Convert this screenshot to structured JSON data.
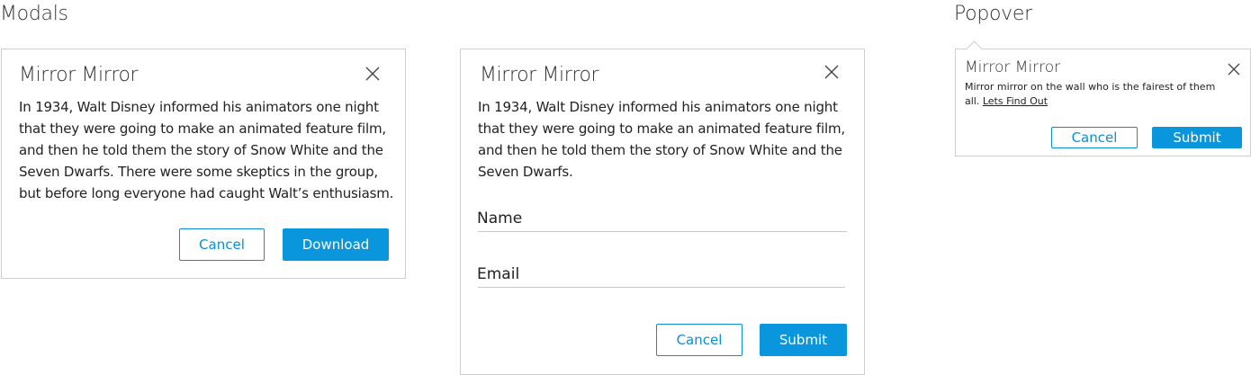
{
  "sections": {
    "modals": "Modals",
    "popover": "Popover"
  },
  "modal1": {
    "title": "Mirror Mirror",
    "body": "In 1934, Walt Disney informed his animators one night that they were going to make an animated feature film, and then he told them the story of Snow White and the Seven Dwarfs. There were some skeptics in the group, but before long everyone had caught Walt’s enthusiasm.",
    "cancel": "Cancel",
    "primary": "Download"
  },
  "modal2": {
    "title": "Mirror Mirror",
    "body": "In 1934, Walt Disney informed his animators one night that they were going to make an animated feature film, and then he told them the story of Snow White and the Seven Dwarfs.",
    "name_label": "Name",
    "email_label": "Email",
    "cancel": "Cancel",
    "primary": "Submit"
  },
  "popover": {
    "title": "Mirror Mirror",
    "body": "Mirror mirror on the wall who is the fairest of them all.",
    "link": "Lets Find Out",
    "cancel": "Cancel",
    "primary": "Submit"
  },
  "colors": {
    "accent": "#0a96dc",
    "border": "#cfcfcf"
  },
  "icons": {
    "close": "close-icon"
  }
}
